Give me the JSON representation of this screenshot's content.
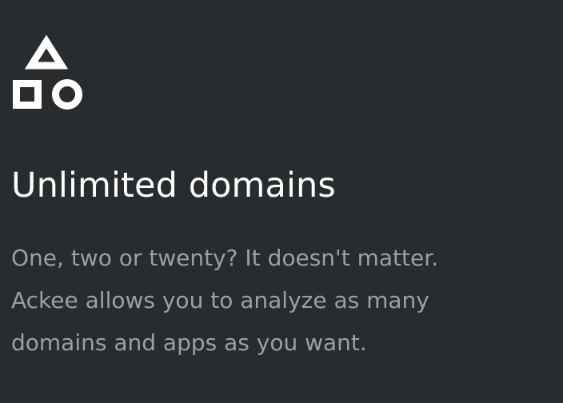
{
  "feature": {
    "icon": "shapes-icon",
    "title": "Unlimited domains",
    "description_lines": [
      "One, two or twenty? It doesn't matter.",
      "Ackee allows you to analyze as many",
      "domains and apps as you want."
    ]
  },
  "colors": {
    "background": "#282c2e",
    "title": "#ffffff",
    "description": "#9aa0a3",
    "icon": "#ffffff"
  }
}
